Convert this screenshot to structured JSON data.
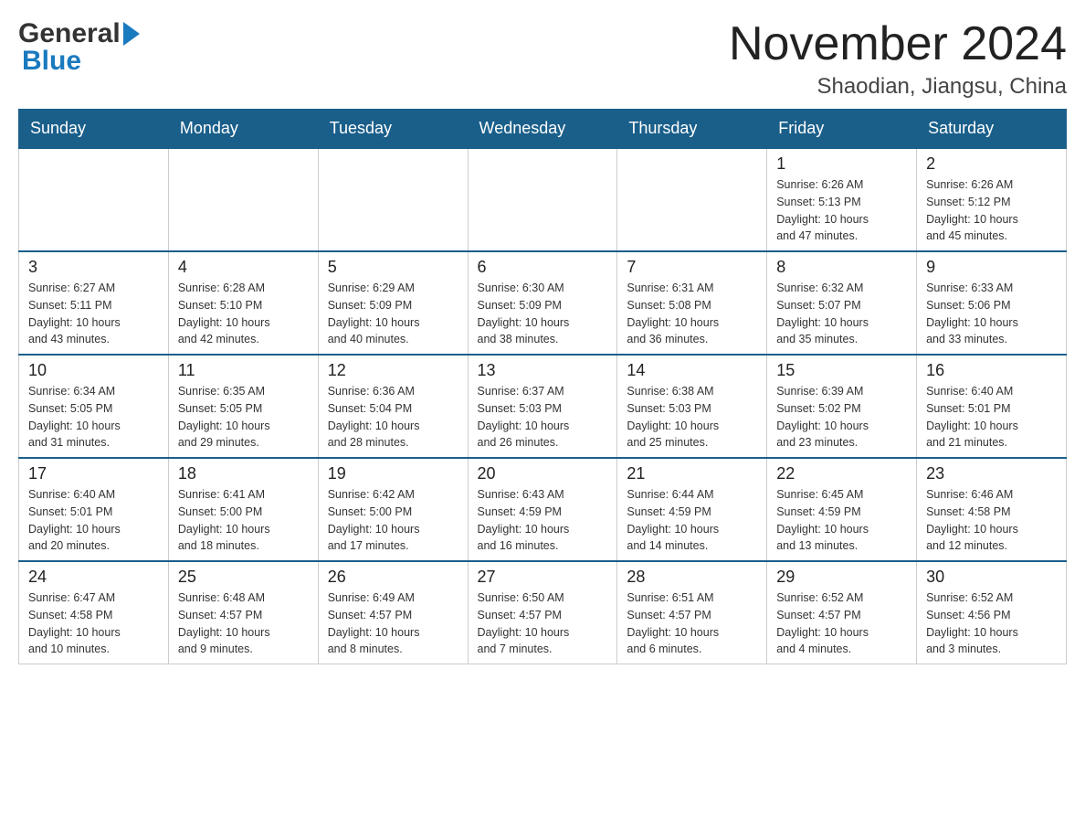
{
  "header": {
    "logo_general": "General",
    "logo_blue": "Blue",
    "month_title": "November 2024",
    "location": "Shaodian, Jiangsu, China"
  },
  "weekdays": [
    "Sunday",
    "Monday",
    "Tuesday",
    "Wednesday",
    "Thursday",
    "Friday",
    "Saturday"
  ],
  "weeks": [
    {
      "days": [
        {
          "number": "",
          "info": ""
        },
        {
          "number": "",
          "info": ""
        },
        {
          "number": "",
          "info": ""
        },
        {
          "number": "",
          "info": ""
        },
        {
          "number": "",
          "info": ""
        },
        {
          "number": "1",
          "info": "Sunrise: 6:26 AM\nSunset: 5:13 PM\nDaylight: 10 hours\nand 47 minutes."
        },
        {
          "number": "2",
          "info": "Sunrise: 6:26 AM\nSunset: 5:12 PM\nDaylight: 10 hours\nand 45 minutes."
        }
      ]
    },
    {
      "days": [
        {
          "number": "3",
          "info": "Sunrise: 6:27 AM\nSunset: 5:11 PM\nDaylight: 10 hours\nand 43 minutes."
        },
        {
          "number": "4",
          "info": "Sunrise: 6:28 AM\nSunset: 5:10 PM\nDaylight: 10 hours\nand 42 minutes."
        },
        {
          "number": "5",
          "info": "Sunrise: 6:29 AM\nSunset: 5:09 PM\nDaylight: 10 hours\nand 40 minutes."
        },
        {
          "number": "6",
          "info": "Sunrise: 6:30 AM\nSunset: 5:09 PM\nDaylight: 10 hours\nand 38 minutes."
        },
        {
          "number": "7",
          "info": "Sunrise: 6:31 AM\nSunset: 5:08 PM\nDaylight: 10 hours\nand 36 minutes."
        },
        {
          "number": "8",
          "info": "Sunrise: 6:32 AM\nSunset: 5:07 PM\nDaylight: 10 hours\nand 35 minutes."
        },
        {
          "number": "9",
          "info": "Sunrise: 6:33 AM\nSunset: 5:06 PM\nDaylight: 10 hours\nand 33 minutes."
        }
      ]
    },
    {
      "days": [
        {
          "number": "10",
          "info": "Sunrise: 6:34 AM\nSunset: 5:05 PM\nDaylight: 10 hours\nand 31 minutes."
        },
        {
          "number": "11",
          "info": "Sunrise: 6:35 AM\nSunset: 5:05 PM\nDaylight: 10 hours\nand 29 minutes."
        },
        {
          "number": "12",
          "info": "Sunrise: 6:36 AM\nSunset: 5:04 PM\nDaylight: 10 hours\nand 28 minutes."
        },
        {
          "number": "13",
          "info": "Sunrise: 6:37 AM\nSunset: 5:03 PM\nDaylight: 10 hours\nand 26 minutes."
        },
        {
          "number": "14",
          "info": "Sunrise: 6:38 AM\nSunset: 5:03 PM\nDaylight: 10 hours\nand 25 minutes."
        },
        {
          "number": "15",
          "info": "Sunrise: 6:39 AM\nSunset: 5:02 PM\nDaylight: 10 hours\nand 23 minutes."
        },
        {
          "number": "16",
          "info": "Sunrise: 6:40 AM\nSunset: 5:01 PM\nDaylight: 10 hours\nand 21 minutes."
        }
      ]
    },
    {
      "days": [
        {
          "number": "17",
          "info": "Sunrise: 6:40 AM\nSunset: 5:01 PM\nDaylight: 10 hours\nand 20 minutes."
        },
        {
          "number": "18",
          "info": "Sunrise: 6:41 AM\nSunset: 5:00 PM\nDaylight: 10 hours\nand 18 minutes."
        },
        {
          "number": "19",
          "info": "Sunrise: 6:42 AM\nSunset: 5:00 PM\nDaylight: 10 hours\nand 17 minutes."
        },
        {
          "number": "20",
          "info": "Sunrise: 6:43 AM\nSunset: 4:59 PM\nDaylight: 10 hours\nand 16 minutes."
        },
        {
          "number": "21",
          "info": "Sunrise: 6:44 AM\nSunset: 4:59 PM\nDaylight: 10 hours\nand 14 minutes."
        },
        {
          "number": "22",
          "info": "Sunrise: 6:45 AM\nSunset: 4:59 PM\nDaylight: 10 hours\nand 13 minutes."
        },
        {
          "number": "23",
          "info": "Sunrise: 6:46 AM\nSunset: 4:58 PM\nDaylight: 10 hours\nand 12 minutes."
        }
      ]
    },
    {
      "days": [
        {
          "number": "24",
          "info": "Sunrise: 6:47 AM\nSunset: 4:58 PM\nDaylight: 10 hours\nand 10 minutes."
        },
        {
          "number": "25",
          "info": "Sunrise: 6:48 AM\nSunset: 4:57 PM\nDaylight: 10 hours\nand 9 minutes."
        },
        {
          "number": "26",
          "info": "Sunrise: 6:49 AM\nSunset: 4:57 PM\nDaylight: 10 hours\nand 8 minutes."
        },
        {
          "number": "27",
          "info": "Sunrise: 6:50 AM\nSunset: 4:57 PM\nDaylight: 10 hours\nand 7 minutes."
        },
        {
          "number": "28",
          "info": "Sunrise: 6:51 AM\nSunset: 4:57 PM\nDaylight: 10 hours\nand 6 minutes."
        },
        {
          "number": "29",
          "info": "Sunrise: 6:52 AM\nSunset: 4:57 PM\nDaylight: 10 hours\nand 4 minutes."
        },
        {
          "number": "30",
          "info": "Sunrise: 6:52 AM\nSunset: 4:56 PM\nDaylight: 10 hours\nand 3 minutes."
        }
      ]
    }
  ]
}
